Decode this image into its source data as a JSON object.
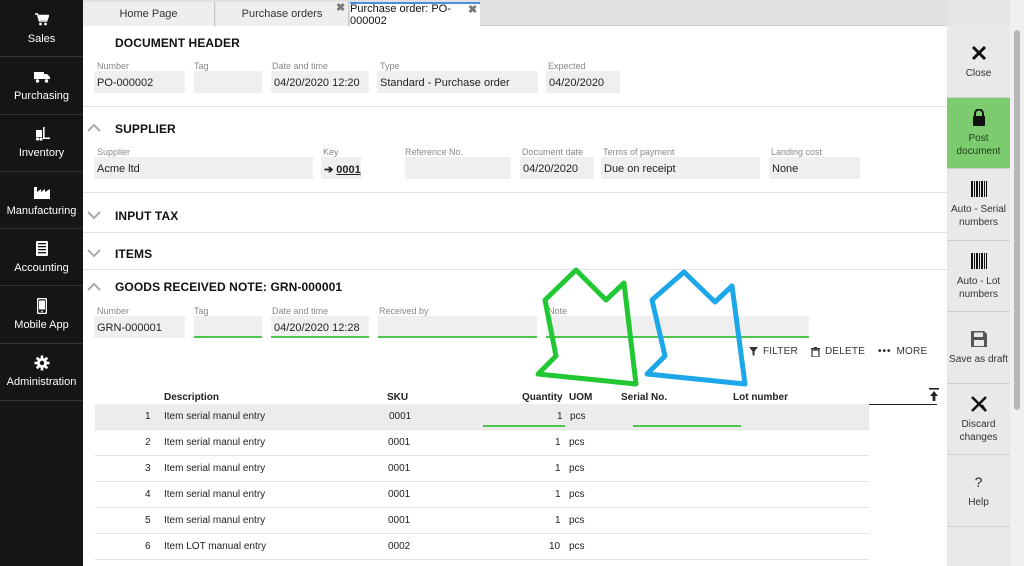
{
  "nav": [
    {
      "label": "Sales",
      "icon": "cart-icon"
    },
    {
      "label": "Purchasing",
      "icon": "truck-icon"
    },
    {
      "label": "Inventory",
      "icon": "forklift-icon"
    },
    {
      "label": "Manufacturing",
      "icon": "factory-icon"
    },
    {
      "label": "Accounting",
      "icon": "ledger-icon"
    },
    {
      "label": "Mobile App",
      "icon": "phone-icon"
    },
    {
      "label": "Administration",
      "icon": "gear-icon"
    }
  ],
  "tabs": {
    "home": "Home Page",
    "orders": "Purchase orders",
    "current": "Purchase order: PO-000002"
  },
  "header": {
    "title": "DOCUMENT HEADER",
    "number_label": "Number",
    "number": "PO-000002",
    "tag_label": "Tag",
    "tag": "",
    "datetime_label": "Date and time",
    "datetime": "04/20/2020 12:20",
    "type_label": "Type",
    "type": "Standard - Purchase order",
    "expected_label": "Expected",
    "expected": "04/20/2020"
  },
  "supplier": {
    "title": "SUPPLIER",
    "supplier_label": "Supplier",
    "supplier": "Acme ltd",
    "key_label": "Key",
    "key": "0001",
    "ref_label": "Reference No.",
    "ref": "",
    "docdate_label": "Document date",
    "docdate": "04/20/2020",
    "terms_label": "Terms of payment",
    "terms": "Due on receipt",
    "landing_label": "Landing cost",
    "landing": "None"
  },
  "sections": {
    "input_tax": "INPUT TAX",
    "items": "ITEMS"
  },
  "grn": {
    "title": "GOODS RECEIVED NOTE: GRN-000001",
    "number_label": "Number",
    "number": "GRN-000001",
    "tag_label": "Tag",
    "tag": "",
    "datetime_label": "Date and time",
    "datetime": "04/20/2020 12:28",
    "received_label": "Received by",
    "received": "",
    "note_label": "Note",
    "note": ""
  },
  "actions": {
    "filter": "FILTER",
    "delete": "DELETE",
    "more": "MORE"
  },
  "table": {
    "headers": {
      "description": "Description",
      "sku": "SKU",
      "quantity": "Quantity",
      "uom": "UOM",
      "serial": "Serial No.",
      "lot": "Lot number"
    },
    "rows": [
      {
        "n": "1",
        "description": "Item serial manul entry",
        "sku": "0001",
        "qty": "1",
        "uom": "pcs"
      },
      {
        "n": "2",
        "description": "Item serial manul entry",
        "sku": "0001",
        "qty": "1",
        "uom": "pcs"
      },
      {
        "n": "3",
        "description": "Item serial manul entry",
        "sku": "0001",
        "qty": "1",
        "uom": "pcs"
      },
      {
        "n": "4",
        "description": "Item serial manul entry",
        "sku": "0001",
        "qty": "1",
        "uom": "pcs"
      },
      {
        "n": "5",
        "description": "Item serial manul entry",
        "sku": "0001",
        "qty": "1",
        "uom": "pcs"
      },
      {
        "n": "6",
        "description": "Item LOT manual entry",
        "sku": "0002",
        "qty": "10",
        "uom": "pcs"
      }
    ]
  },
  "right_actions": [
    {
      "label": "Close",
      "icon": "close-icon"
    },
    {
      "label": "Post document",
      "icon": "lock-icon"
    },
    {
      "label": "Auto - Serial numbers",
      "icon": "barcode-icon"
    },
    {
      "label": "Auto - Lot numbers",
      "icon": "barcode-icon"
    },
    {
      "label": "Save as draft",
      "icon": "save-icon"
    },
    {
      "label": "Discard changes",
      "icon": "discard-icon"
    },
    {
      "label": "Help",
      "icon": "help-icon"
    }
  ],
  "colors": {
    "post_green": "#7ccb6f",
    "field_green": "#4fc44f",
    "arrow_green": "#22c833",
    "arrow_blue": "#1ea7e8",
    "nav_bg": "#151515"
  }
}
